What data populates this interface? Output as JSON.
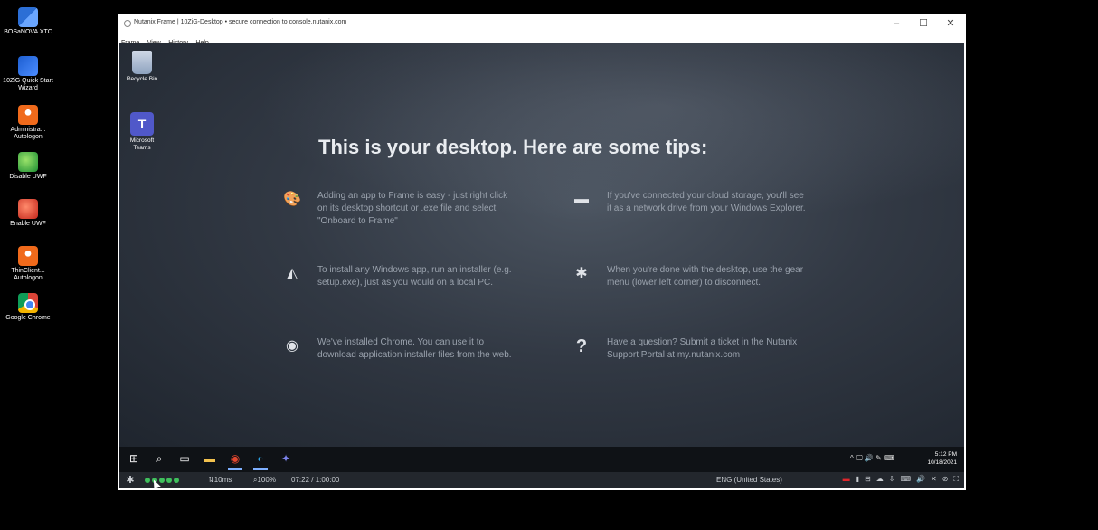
{
  "host_desktop": {
    "icons": [
      {
        "label": "BOSaNOVA XTC",
        "icon": "tiles-icon"
      },
      {
        "label": "10ZiG Quick Start Wizard",
        "icon": "10zig-icon"
      },
      {
        "label": "Administra... Autologon",
        "icon": "user-orange-icon"
      },
      {
        "label": "Disable UWF",
        "icon": "globe-green-icon"
      },
      {
        "label": "Enable UWF",
        "icon": "globe-red-icon"
      },
      {
        "label": "ThinClient... Autologon",
        "icon": "user-orange-icon"
      },
      {
        "label": "Google Chrome",
        "icon": "chrome-icon"
      }
    ]
  },
  "window": {
    "title": "Nutanix Frame | 10ZiG-Desktop • secure connection to console.nutanix.com",
    "controls": {
      "minimize": "–",
      "maximize": "☐",
      "close": "✕"
    },
    "menu": [
      "Frame",
      "View",
      "History",
      "Help"
    ]
  },
  "remote_desktop": {
    "icons": [
      {
        "label": "Recycle Bin"
      },
      {
        "label": "Microsoft Teams",
        "glyph": "T"
      }
    ],
    "heading": "This is your desktop. Here are some tips:",
    "tips": [
      {
        "icon": "palette-icon",
        "glyph": "🎨",
        "text": "Adding an app to Frame is easy - just right click on its desktop shortcut or .exe file and select \"Onboard to Frame\""
      },
      {
        "icon": "folder-icon",
        "glyph": "▬",
        "text": "If you've connected your cloud storage, you'll see it as a network drive from your Windows Explorer."
      },
      {
        "icon": "installer-icon",
        "glyph": "◭",
        "text": "To install any Windows app, run an installer (e.g. setup.exe), just as you would on a local PC."
      },
      {
        "icon": "gear-icon",
        "glyph": "✱",
        "text": "When you're done with the desktop, use the gear menu (lower left corner) to disconnect."
      },
      {
        "icon": "chrome-icon",
        "glyph": "◉",
        "text": "We've installed Chrome. You can use it to download application installer files from the web."
      },
      {
        "icon": "question-icon",
        "glyph": "?",
        "text": "Have a question? Submit a ticket in the Nutanix Support Portal at my.nutanix.com"
      }
    ],
    "taskbar": {
      "tray": "^ 🖵 🔊 ✎ ⌨",
      "time": "5:12 PM",
      "date": "10/18/2021"
    }
  },
  "status_bar": {
    "latency": "⇅10ms",
    "zoom": "⌕100%",
    "session_time": "07:22 / 1:00:00",
    "language": "ENG (United States)"
  }
}
